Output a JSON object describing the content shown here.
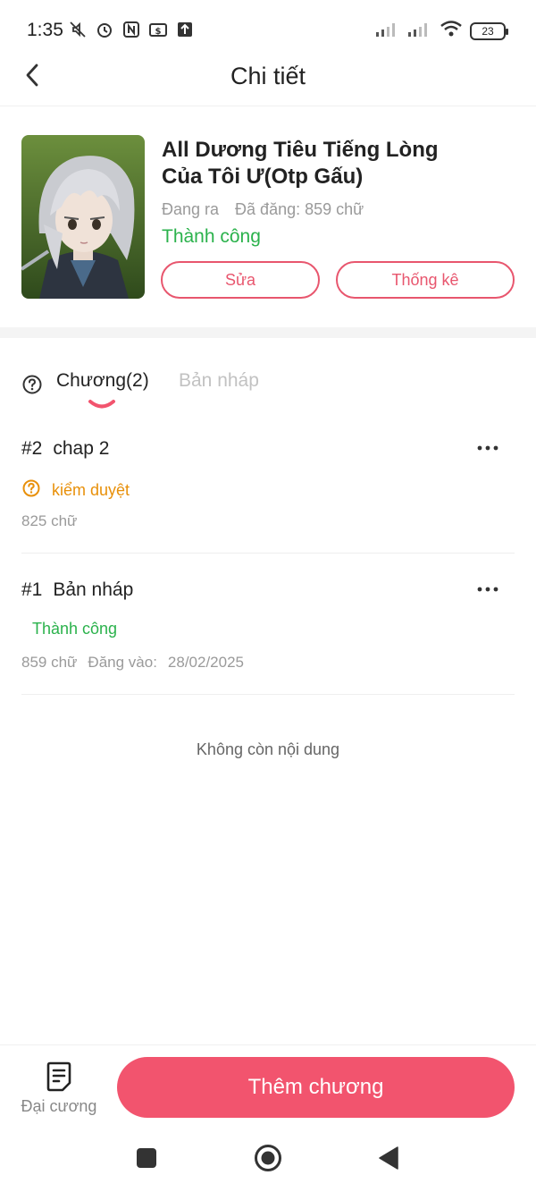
{
  "status_bar": {
    "time": "1:35",
    "battery": "23",
    "icons_left": [
      "mute-icon",
      "alarm-icon",
      "nfc-icon",
      "money-icon",
      "upload-icon"
    ],
    "icons_right": [
      "signal-icon",
      "signal-icon",
      "wifi-icon",
      "battery-icon"
    ]
  },
  "header": {
    "title": "Chi tiết",
    "back_icon": "chevron-left-icon"
  },
  "book": {
    "title": "All Dương Tiêu Tiếng Lòng Của Tôi Ư(Otp Gấu)",
    "state": "Đang ra",
    "published": "Đã đăng: 859 chữ",
    "status": "Thành công",
    "edit_label": "Sửa",
    "stats_label": "Thống kê"
  },
  "tabs": {
    "chapters_label": "Chương(2)",
    "drafts_label": "Bản nháp",
    "active": "chapters"
  },
  "chapters": [
    {
      "number": "#2",
      "title": "chap 2",
      "status": "kiểm duyệt",
      "words": "825 chữ",
      "posted_label": "",
      "posted_date": ""
    },
    {
      "number": "#1",
      "title": "Bản nháp",
      "status": "Thành công",
      "words": "859 chữ",
      "posted_label": "Đăng vào:",
      "posted_date": "28/02/2025"
    }
  ],
  "empty_note": "Không còn nội dung",
  "bottom": {
    "outline_label": "Đại cương",
    "add_chapter_label": "Thêm chương"
  },
  "colors": {
    "accent": "#f2546e",
    "success": "#2bb24c",
    "review": "#e8900a",
    "muted": "#9a9a9a"
  }
}
